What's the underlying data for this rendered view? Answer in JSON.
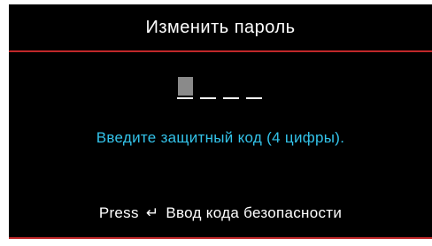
{
  "dialog": {
    "title": "Изменить пароль",
    "code_slots": [
      {
        "state": "active"
      },
      {
        "state": "empty"
      },
      {
        "state": "empty"
      },
      {
        "state": "empty"
      }
    ],
    "hint": "Введите защитный код (4 цифры).",
    "footer": {
      "press_label": "Press",
      "enter_icon": "enter-return-icon",
      "enter_glyph": "↵",
      "action_label": "Ввод кода безопасности"
    }
  },
  "colors": {
    "background": "#000000",
    "accent_line": "#c0282a",
    "hint_text": "#33c3ea",
    "text": "#ffffff",
    "active_slot": "#8a8a8a"
  }
}
